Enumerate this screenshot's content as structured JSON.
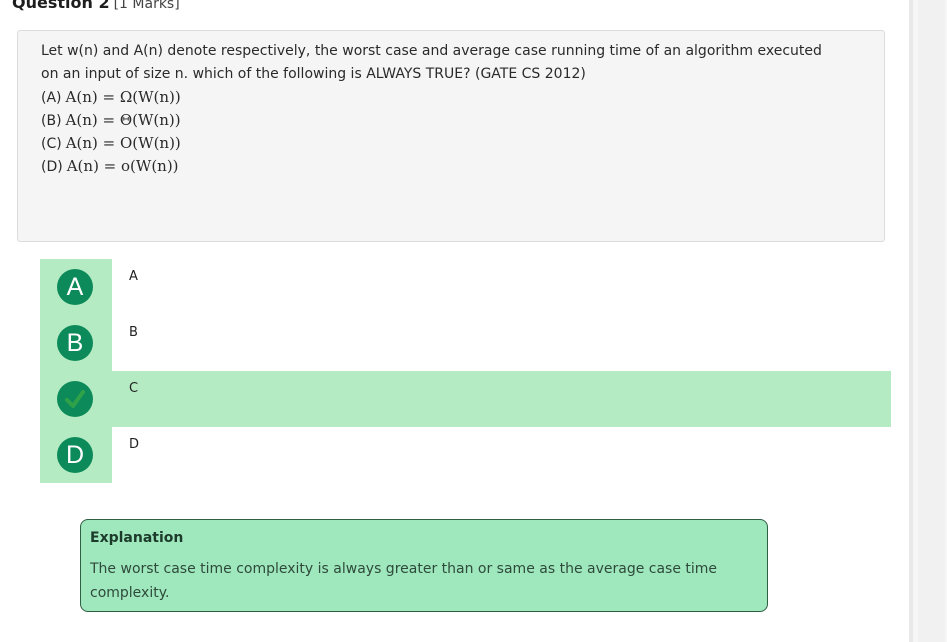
{
  "question": {
    "title": "Question 2",
    "marks": "[1 Marks]",
    "text": "Let w(n) and A(n) denote respectively, the worst case and average case running time of an algorithm executed on an input of size n. which of the following is ALWAYS TRUE? (GATE CS 2012)",
    "statements": [
      {
        "label": "(A)",
        "math": "A(n) = Ω(W(n))"
      },
      {
        "label": "(B)",
        "math": "A(n) = Θ(W(n))"
      },
      {
        "label": "(C)",
        "math": "A(n) = O(W(n))"
      },
      {
        "label": "(D)",
        "math": "A(n) = o(W(n))"
      }
    ]
  },
  "options": [
    {
      "letter": "A",
      "text": "A",
      "correct": false
    },
    {
      "letter": "B",
      "text": "B",
      "correct": false
    },
    {
      "letter": "C",
      "text": "C",
      "correct": true
    },
    {
      "letter": "D",
      "text": "D",
      "correct": false
    }
  ],
  "explanation": {
    "title": "Explanation",
    "body": "The worst case time complexity is always greater than or same as the average case time complexity."
  },
  "icons": {
    "correct": "check-icon"
  },
  "colors": {
    "accent": "#0d8a5a",
    "correct_bg": "#b4ebc3",
    "explanation_bg": "#9fe7bd",
    "check": "#2fa148"
  }
}
